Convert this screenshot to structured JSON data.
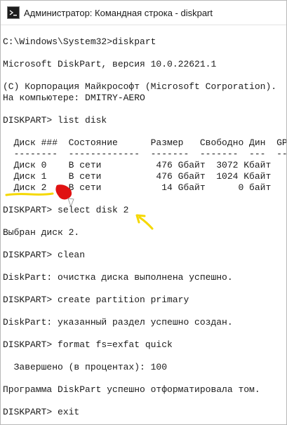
{
  "window": {
    "title": "Администратор: Командная строка - diskpart",
    "icon": "console-icon"
  },
  "console": {
    "lines": [
      "",
      "C:\\Windows\\System32>diskpart",
      "",
      "Microsoft DiskPart, версия 10.0.22621.1",
      "",
      "(C) Корпорация Майкрософт (Microsoft Corporation).",
      "На компьютере: DMITRY-AERO",
      "",
      "DISKPART> list disk",
      "",
      "  Диск ###  Состояние      Размер   Свободно Дин  GPT",
      "  --------  -------------  -------  -------  ---  ---",
      "  Диск 0    В сети          476 Gбайт  3072 Kбайт",
      "  Диск 1    В сети          476 Gбайт  1024 Kбайт",
      "  Диск 2    В сети           14 Gбайт      0 байт",
      "",
      "DISKPART> select disk 2",
      "",
      "Выбран диск 2.",
      "",
      "DISKPART> clean",
      "",
      "DiskPart: очистка диска выполнена успешно.",
      "",
      "DISKPART> create partition primary",
      "",
      "DiskPart: указанный раздел успешно создан.",
      "",
      "DISKPART> format fs=exfat quick",
      "",
      "  Завершено (в процентах): 100",
      "",
      "Программа DiskPart успешно отформатировала том.",
      "",
      "DISKPART> exit"
    ]
  },
  "annotations": {
    "underline_color": "#f5d800",
    "blob_color": "#e01212",
    "arrow_color": "#f5d800"
  }
}
